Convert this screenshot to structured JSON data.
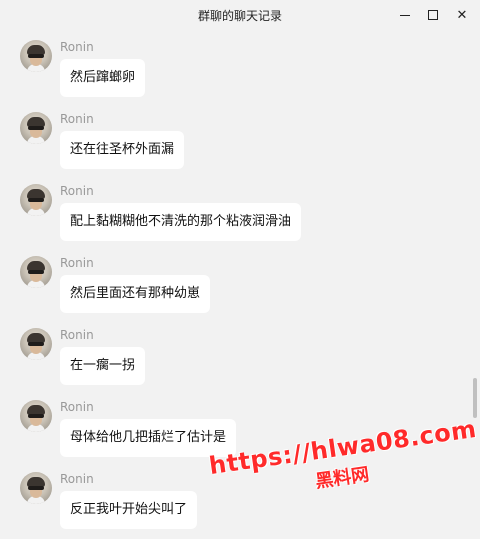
{
  "window": {
    "title": "群聊的聊天记录",
    "min_icon": "minimize-icon",
    "max_icon": "maximize-icon",
    "close_icon": "close-icon"
  },
  "messages": [
    {
      "sender": "Ronin",
      "text": "然后蹿螂卵"
    },
    {
      "sender": "Ronin",
      "text": "还在往圣杯外面漏"
    },
    {
      "sender": "Ronin",
      "text": "配上黏糊糊他不清洗的那个粘液润滑油"
    },
    {
      "sender": "Ronin",
      "text": "然后里面还有那种幼崽"
    },
    {
      "sender": "Ronin",
      "text": "在一瘸一拐"
    },
    {
      "sender": "Ronin",
      "text": "母体给他几把插烂了估计是"
    },
    {
      "sender": "Ronin",
      "text": "反正我叶开始尖叫了"
    }
  ],
  "watermark": {
    "url": "https://hlwa08.com",
    "site": "黑料网"
  }
}
